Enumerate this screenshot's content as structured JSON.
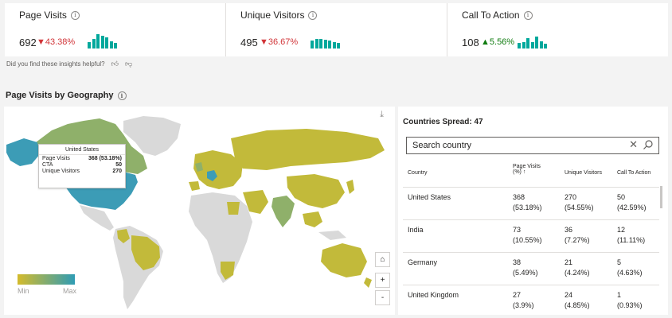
{
  "kpis": [
    {
      "title": "Page Visits",
      "value": "692",
      "delta": "43.38%",
      "direction": "down",
      "spark": [
        8,
        12,
        18,
        16,
        14,
        9,
        7
      ]
    },
    {
      "title": "Unique Visitors",
      "value": "495",
      "delta": "36.67%",
      "direction": "down",
      "spark": [
        10,
        12,
        12,
        11,
        10,
        8,
        7
      ]
    },
    {
      "title": "Call To Action",
      "value": "108",
      "delta": "5.56%",
      "direction": "up",
      "spark": [
        7,
        8,
        13,
        8,
        15,
        9,
        6
      ]
    }
  ],
  "helpful_text": "Did you find these insights helpful?",
  "section_title": "Page Visits by Geography",
  "tooltip": {
    "title": "United States",
    "rows": [
      {
        "label": "Page Visits",
        "value": "368 (53.18%)"
      },
      {
        "label": "CTA",
        "value": "50"
      },
      {
        "label": "Unique Visitors",
        "value": "270"
      }
    ]
  },
  "map_controls": {
    "home": "⌂",
    "zoom_in": "+",
    "zoom_out": "-"
  },
  "legend": {
    "min": "Min",
    "max": "Max",
    "min_color": "#d4bb2c",
    "max_color": "#2f9cb4"
  },
  "table": {
    "spread_label": "Countries Spread: 47",
    "search_placeholder": "Search country",
    "columns": {
      "country": "Country",
      "page_visits_line1": "Page Visits",
      "page_visits_line2": "(%) ↑",
      "unique": "Unique Visitors",
      "cta": "Call To Action"
    },
    "rows": [
      {
        "country": "United States",
        "pv": "368",
        "pv_pct": "(53.18%)",
        "uv": "270",
        "uv_pct": "(54.55%)",
        "cta": "50",
        "cta_pct": "(42.59%)"
      },
      {
        "country": "India",
        "pv": "73",
        "pv_pct": "(10.55%)",
        "uv": "36",
        "uv_pct": "(7.27%)",
        "cta": "12",
        "cta_pct": "(11.11%)"
      },
      {
        "country": "Germany",
        "pv": "38",
        "pv_pct": "(5.49%)",
        "uv": "21",
        "uv_pct": "(4.24%)",
        "cta": "5",
        "cta_pct": "(4.63%)"
      },
      {
        "country": "United Kingdom",
        "pv": "27",
        "pv_pct": "(3.9%)",
        "uv": "24",
        "uv_pct": "(4.85%)",
        "cta": "1",
        "cta_pct": "(0.93%)"
      }
    ]
  },
  "colors": {
    "accent_teal": "#00a89c",
    "down_red": "#d13438",
    "up_green": "#107c10",
    "map_no_data": "#d9d9d9",
    "map_low": "#c2ba3a",
    "map_mid": "#8fb06a",
    "map_high": "#3c9cb6"
  }
}
